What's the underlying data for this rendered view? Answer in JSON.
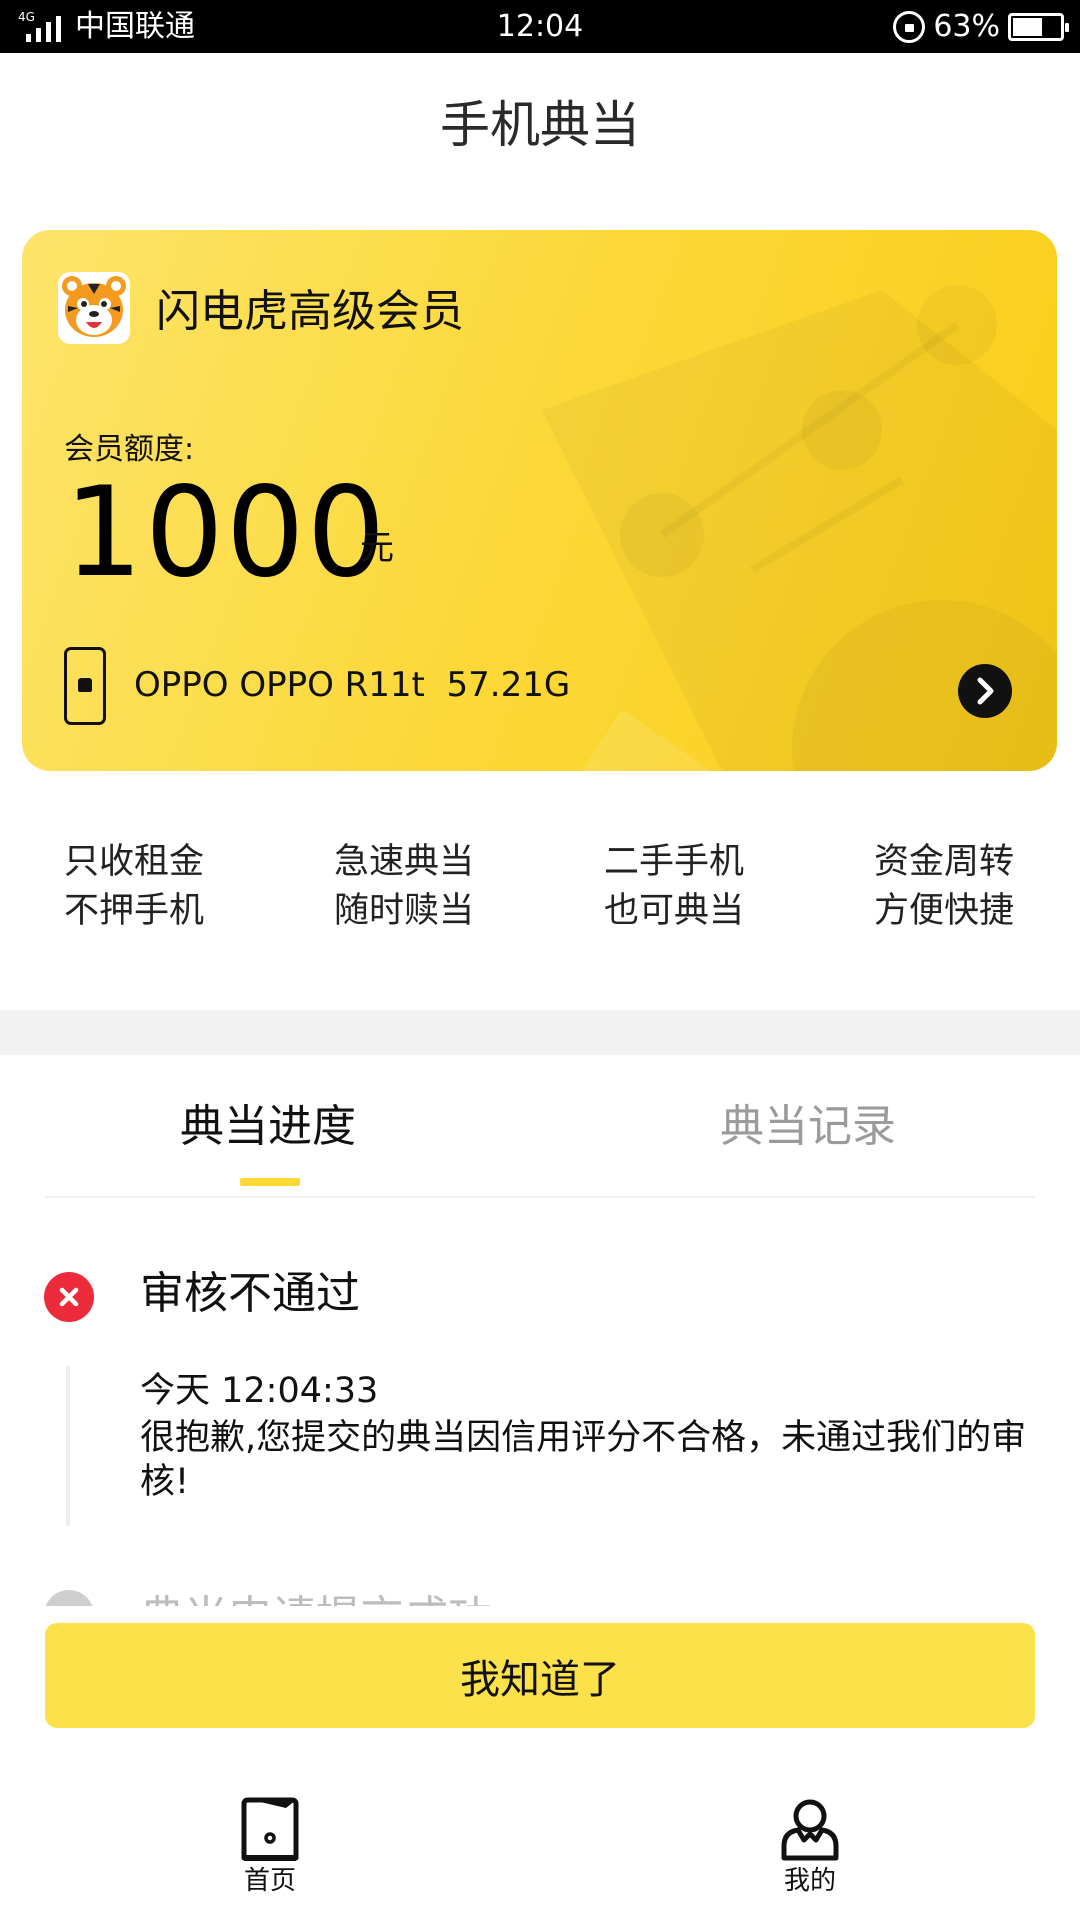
{
  "status_bar": {
    "network": "4G",
    "carrier": "中国联通",
    "time": "12:04",
    "battery_pct": "63%",
    "battery_level": 0.63
  },
  "header": {
    "title": "手机典当"
  },
  "member_card": {
    "name": "闪电虎高级会员",
    "quota_label": "会员额度:",
    "quota_value": "1000",
    "quota_unit": "元",
    "device_info": "OPPO OPPO R11t  57.21G",
    "colors": {
      "card_start": "#fde46a",
      "card_end": "#f9cc18"
    }
  },
  "features": [
    {
      "line1": "只收租金",
      "line2": "不押手机"
    },
    {
      "line1": "急速典当",
      "line2": "随时赎当"
    },
    {
      "line1": "二手手机",
      "line2": "也可典当"
    },
    {
      "line1": "资金周转",
      "line2": "方便快捷"
    }
  ],
  "tabs": [
    {
      "label": "典当进度",
      "active": true
    },
    {
      "label": "典当记录",
      "active": false
    }
  ],
  "progress": {
    "status_title": "审核不通过",
    "event_time": "今天 12:04:33",
    "event_message": "很抱歉,您提交的典当因信用评分不合格，未通过我们的审核!",
    "next_step_title": "典当申请提交成功"
  },
  "actions": {
    "acknowledge_label": "我知道了"
  },
  "bottom_nav": [
    {
      "label": "首页",
      "icon": "phone-home-icon"
    },
    {
      "label": "我的",
      "icon": "person-icon"
    }
  ],
  "colors": {
    "accent": "#fcd837",
    "button": "#fce14a",
    "error": "#ec2b3a"
  }
}
